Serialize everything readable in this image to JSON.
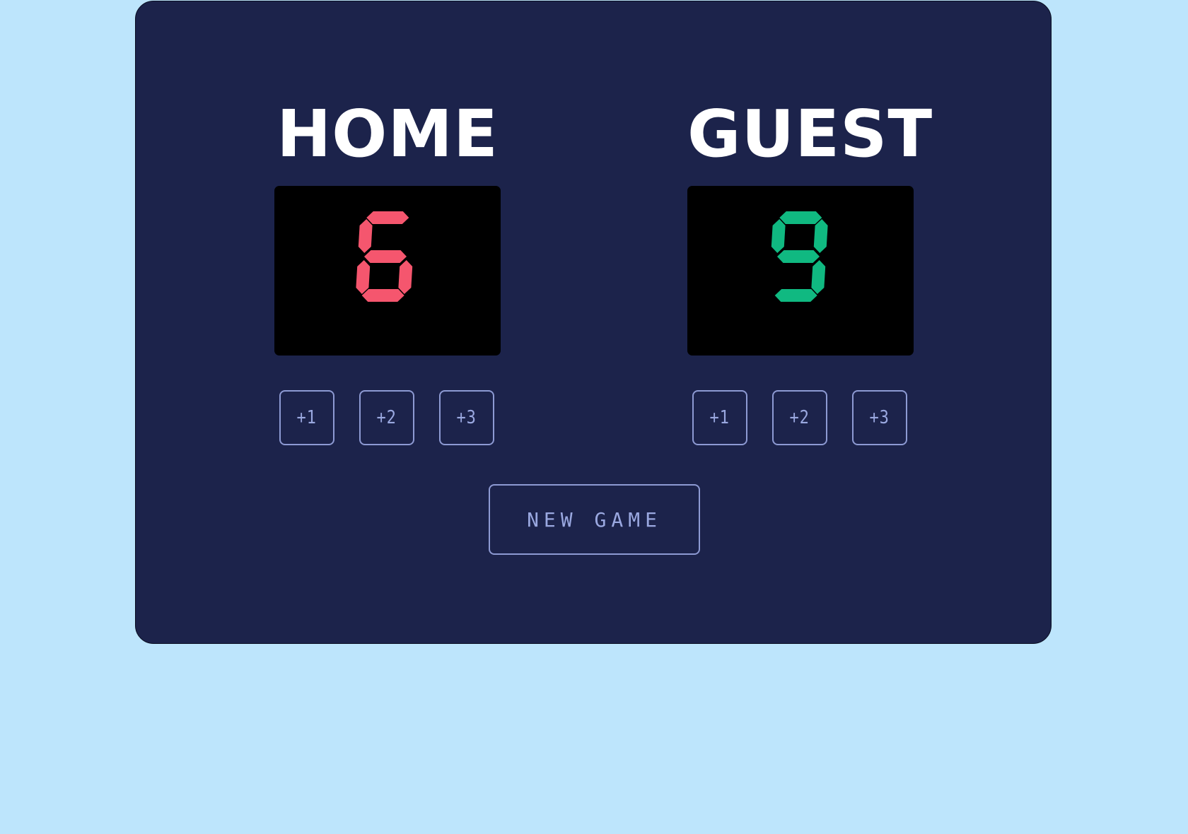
{
  "colors": {
    "background": "#bde5fc",
    "board": "#1c234b",
    "home_digit": "#f5566e",
    "guest_digit": "#10b981",
    "button_border": "#8d9ad3"
  },
  "home": {
    "name": "HOME",
    "score": 6,
    "buttons": [
      "+1",
      "+2",
      "+3"
    ]
  },
  "guest": {
    "name": "GUEST",
    "score": 9,
    "buttons": [
      "+1",
      "+2",
      "+3"
    ]
  },
  "controls": {
    "new_game_label": "NEW GAME"
  }
}
